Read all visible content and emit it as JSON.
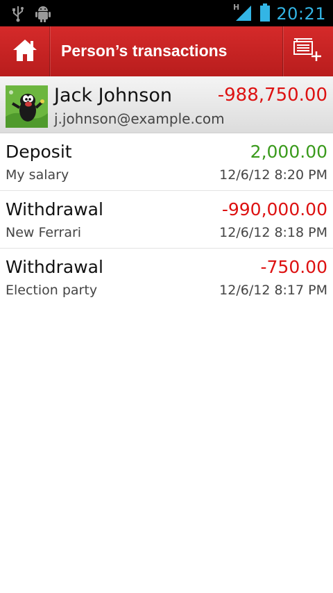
{
  "status_bar": {
    "time": "20:21",
    "network_label": "H",
    "icons": [
      "usb-icon",
      "android-debug-icon",
      "signal-icon",
      "battery-icon"
    ]
  },
  "action_bar": {
    "title": "Person’s transactions",
    "home_icon": "home-icon",
    "add_icon": "add-transaction-icon",
    "color": "#c62222"
  },
  "person": {
    "name": "Jack Johnson",
    "email": "j.johnson@example.com",
    "balance": "-988,750.00"
  },
  "transactions": [
    {
      "type": "Deposit",
      "note": "My salary",
      "amount": "2,000.00",
      "date": "12/6/12 8:20 PM",
      "sign": "positive"
    },
    {
      "type": "Withdrawal",
      "note": "New Ferrari",
      "amount": "-990,000.00",
      "date": "12/6/12 8:18 PM",
      "sign": "negative"
    },
    {
      "type": "Withdrawal",
      "note": "Election party",
      "amount": "-750.00",
      "date": "12/6/12 8:17 PM",
      "sign": "negative"
    }
  ],
  "colors": {
    "positive": "#3a9a1c",
    "negative": "#dd1111",
    "accent": "#33b5e5"
  }
}
